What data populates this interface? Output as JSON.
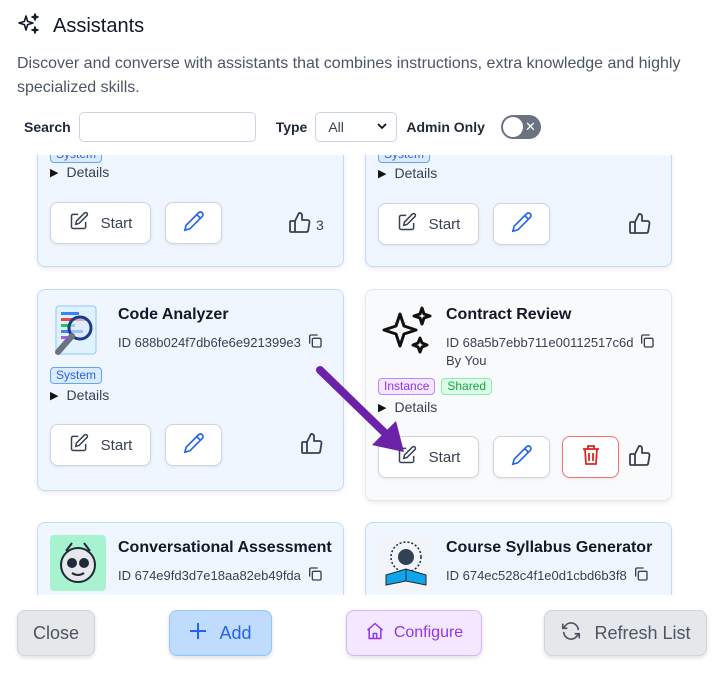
{
  "header": {
    "title": "Assistants",
    "icon": "sparkles-icon"
  },
  "description": "Discover and converse with assistants that combines instructions, extra knowledge and highly specialized skills.",
  "filters": {
    "search_label": "Search",
    "search_value": "",
    "type_label": "Type",
    "type_value": "All",
    "admin_only_label": "Admin Only",
    "admin_only": false
  },
  "cards": [
    {
      "badges": [
        "System"
      ],
      "details_label": "Details",
      "start_label": "Start",
      "likes": "3"
    },
    {
      "badges": [
        "System"
      ],
      "details_label": "Details",
      "start_label": "Start",
      "likes": ""
    },
    {
      "name": "Code Analyzer",
      "id": "ID 688b024f7db6fe6e921399e3",
      "badges": [
        "System"
      ],
      "details_label": "Details",
      "start_label": "Start",
      "likes": ""
    },
    {
      "name": "Contract Review",
      "id": "ID 68a5b7ebb711e00112517c6d",
      "byline": "By You",
      "badges": [
        "Instance",
        "Shared"
      ],
      "details_label": "Details",
      "start_label": "Start",
      "likes": ""
    },
    {
      "name": "Conversational Assessment",
      "id": "ID 674e9fd3d7e18aa82eb49fda"
    },
    {
      "name": "Course Syllabus Generator",
      "id": "ID 674ec528c4f1e0d1cbd6b3f8"
    }
  ],
  "footer": {
    "close_label": "Close",
    "add_label": "Add",
    "configure_label": "Configure",
    "refresh_label": "Refresh List"
  },
  "colors": {
    "accent_blue": "#2563eb",
    "card_blue_bg": "#eff6ff",
    "delete_red": "#dc2626",
    "annotation_arrow": "#6b21a8"
  }
}
